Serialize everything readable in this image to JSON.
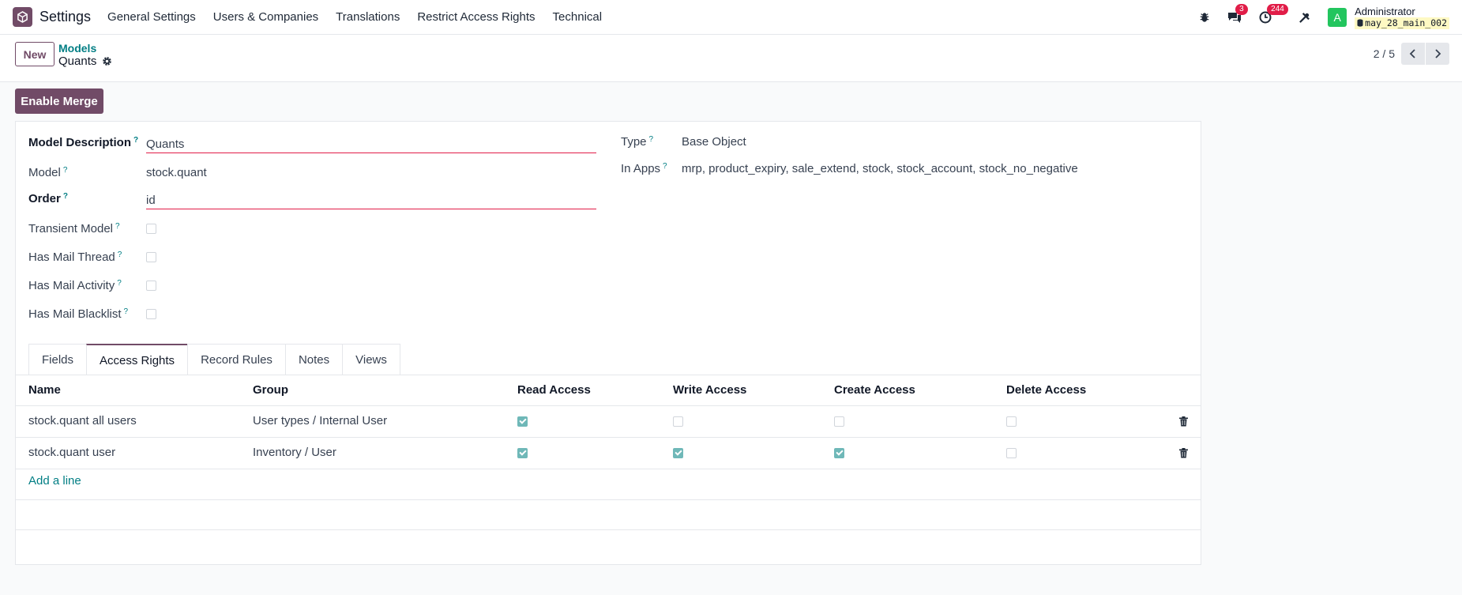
{
  "navbar": {
    "app_name": "Settings",
    "menu": [
      "General Settings",
      "Users & Companies",
      "Translations",
      "Restrict Access Rights",
      "Technical"
    ],
    "chat_badge": "3",
    "activity_badge": "244",
    "avatar_letter": "A",
    "user_name": "Administrator",
    "db_name": "may_28_main_002"
  },
  "control": {
    "new_label": "New",
    "breadcrumb_parent": "Models",
    "breadcrumb_current": "Quants",
    "pager": "2 / 5"
  },
  "actions": {
    "merge_label": "Enable Merge"
  },
  "form": {
    "model_description_label": "Model Description",
    "model_description_value": "Quants",
    "model_label": "Model",
    "model_value": "stock.quant",
    "order_label": "Order",
    "order_value": "id",
    "transient_label": "Transient Model",
    "mail_thread_label": "Has Mail Thread",
    "mail_activity_label": "Has Mail Activity",
    "mail_blacklist_label": "Has Mail Blacklist",
    "type_label": "Type",
    "type_value": "Base Object",
    "in_apps_label": "In Apps",
    "in_apps_value": "mrp, product_expiry, sale_extend, stock, stock_account, stock_no_negative",
    "help_mark": "?"
  },
  "tabs": [
    "Fields",
    "Access Rights",
    "Record Rules",
    "Notes",
    "Views"
  ],
  "active_tab": "Access Rights",
  "access_table": {
    "headers": [
      "Name",
      "Group",
      "Read Access",
      "Write Access",
      "Create Access",
      "Delete Access"
    ],
    "rows": [
      {
        "name": "stock.quant all users",
        "group": "User types / Internal User",
        "read": true,
        "write": false,
        "create": false,
        "delete": false
      },
      {
        "name": "stock.quant user",
        "group": "Inventory / User",
        "read": true,
        "write": true,
        "create": true,
        "delete": false
      }
    ],
    "add_line_label": "Add a line"
  },
  "colors": {
    "brand": "#714b67",
    "link": "#017e84",
    "required_underline": "#e11d48",
    "checked": "#6fb8b8"
  }
}
